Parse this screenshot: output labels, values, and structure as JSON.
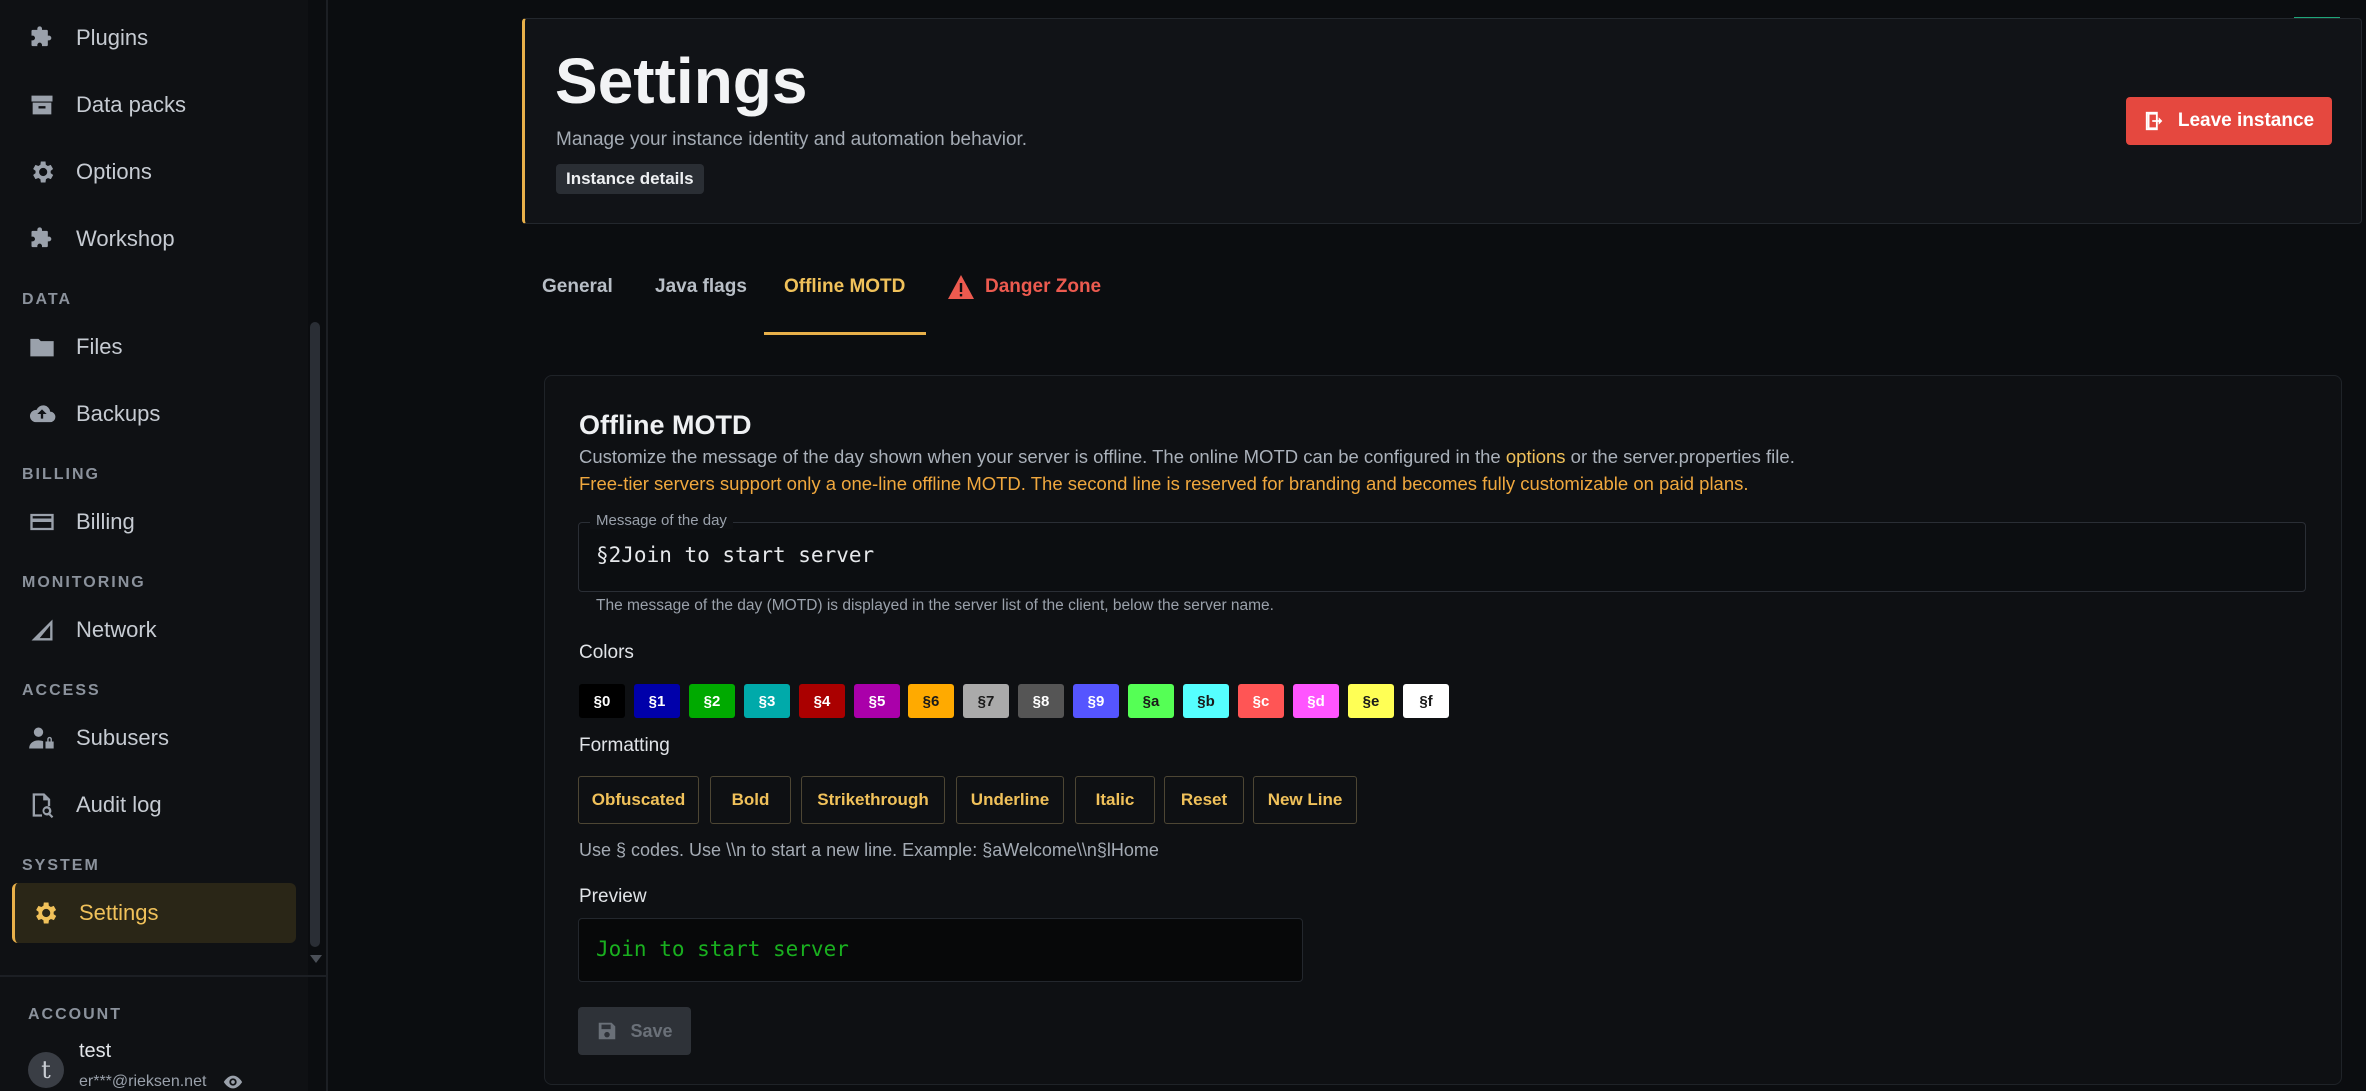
{
  "sidebar": {
    "items": [
      {
        "label": "Plugins",
        "icon": "puzzle-icon"
      },
      {
        "label": "Data packs",
        "icon": "archive-icon"
      },
      {
        "label": "Options",
        "icon": "gear-icon"
      },
      {
        "label": "Workshop",
        "icon": "puzzle-icon"
      },
      {
        "label": "Files",
        "icon": "folder-icon"
      },
      {
        "label": "Backups",
        "icon": "cloud-upload-icon"
      },
      {
        "label": "Billing",
        "icon": "credit-card-icon"
      },
      {
        "label": "Network",
        "icon": "signal-icon"
      },
      {
        "label": "Subusers",
        "icon": "user-lock-icon"
      },
      {
        "label": "Audit log",
        "icon": "file-search-icon"
      },
      {
        "label": "Settings",
        "icon": "gear-icon",
        "active": true
      }
    ],
    "sections": {
      "data": "DATA",
      "billing": "BILLING",
      "monitoring": "MONITORING",
      "access": "ACCESS",
      "system": "SYSTEM"
    },
    "account": {
      "heading": "ACCOUNT",
      "avatar_letter": "t",
      "name": "test",
      "email": "er***@rieksen.net"
    }
  },
  "header": {
    "title": "Settings",
    "subtitle": "Manage your instance identity and automation behavior.",
    "badge": "Instance details",
    "leave_label": "Leave instance"
  },
  "tabs": [
    {
      "label": "General"
    },
    {
      "label": "Java flags"
    },
    {
      "label": "Offline MOTD",
      "active": true
    },
    {
      "label": "Danger Zone",
      "danger": true
    }
  ],
  "motd": {
    "title": "Offline MOTD",
    "desc_before": "Customize the message of the day shown when your server is offline. The online MOTD can be configured in the ",
    "desc_link": "options",
    "desc_after": " or the server.properties file.",
    "warning": "Free-tier servers support only a one-line offline MOTD. The second line is reserved for branding and becomes fully customizable on paid plans.",
    "field_label": "Message of the day",
    "field_value": "§2Join to start server",
    "field_help": "The message of the day (MOTD) is displayed in the server list of the client, below the server name.",
    "colors_heading": "Colors",
    "colors": [
      {
        "code": "§0",
        "bg": "#000000",
        "fg": "#ffffff"
      },
      {
        "code": "§1",
        "bg": "#0000aa",
        "fg": "#ffffff"
      },
      {
        "code": "§2",
        "bg": "#00aa00",
        "fg": "#ffffff"
      },
      {
        "code": "§3",
        "bg": "#00aaaa",
        "fg": "#ffffff"
      },
      {
        "code": "§4",
        "bg": "#aa0000",
        "fg": "#ffffff"
      },
      {
        "code": "§5",
        "bg": "#aa00aa",
        "fg": "#ffffff"
      },
      {
        "code": "§6",
        "bg": "#ffaa00",
        "fg": "#1a1a1a"
      },
      {
        "code": "§7",
        "bg": "#aaaaaa",
        "fg": "#1a1a1a"
      },
      {
        "code": "§8",
        "bg": "#555555",
        "fg": "#ffffff"
      },
      {
        "code": "§9",
        "bg": "#5555ff",
        "fg": "#ffffff"
      },
      {
        "code": "§a",
        "bg": "#55ff55",
        "fg": "#1a1a1a"
      },
      {
        "code": "§b",
        "bg": "#55ffff",
        "fg": "#1a1a1a"
      },
      {
        "code": "§c",
        "bg": "#ff5555",
        "fg": "#ffffff"
      },
      {
        "code": "§d",
        "bg": "#ff55ff",
        "fg": "#ffffff"
      },
      {
        "code": "§e",
        "bg": "#ffff55",
        "fg": "#1a1a1a"
      },
      {
        "code": "§f",
        "bg": "#ffffff",
        "fg": "#1a1a1a"
      }
    ],
    "formatting_heading": "Formatting",
    "formatting": [
      "Obfuscated",
      "Bold",
      "Strikethrough",
      "Underline",
      "Italic",
      "Reset",
      "New Line"
    ],
    "codes_help": "Use § codes. Use \\\\n to start a new line. Example: §aWelcome\\\\n§lHome",
    "preview_heading": "Preview",
    "preview_text": "Join to start server",
    "save_label": "Save"
  }
}
